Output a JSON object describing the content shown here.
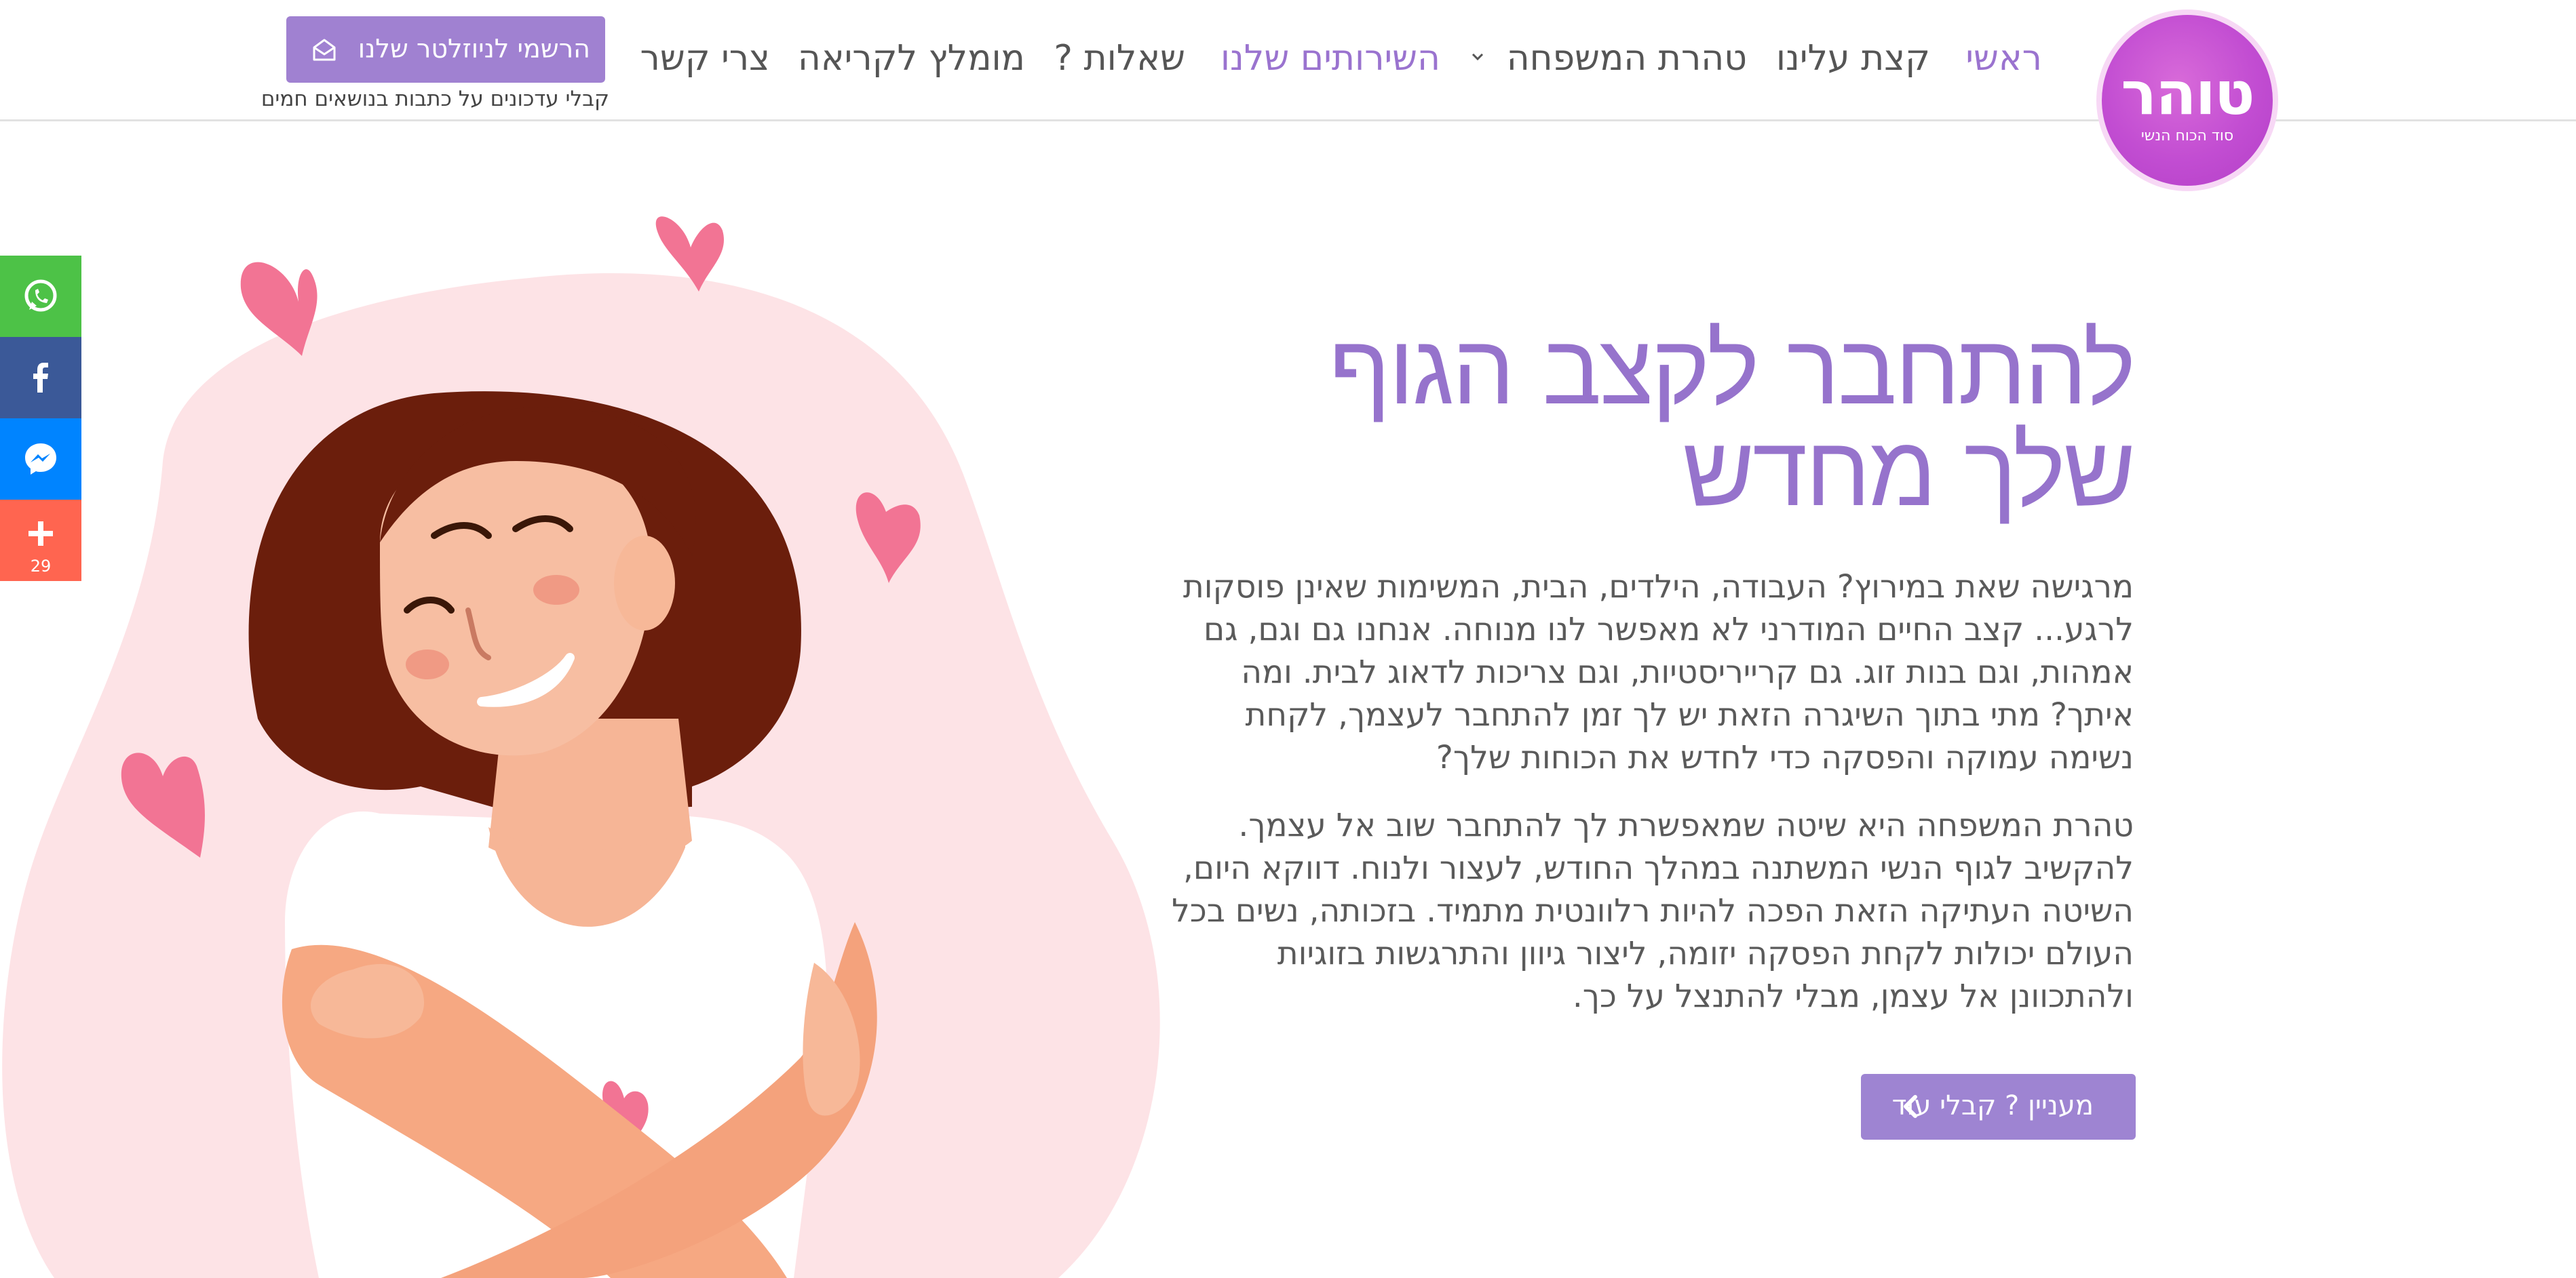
{
  "header": {
    "logo_text": "טוהר",
    "logo_subtitle": "סוד הכוח הנשי",
    "nav": [
      {
        "label": "ראשי",
        "active": true
      },
      {
        "label": "קצת עלינו",
        "active": false
      },
      {
        "label": "טהרת המשפחה",
        "active": false
      },
      {
        "label": "השירותים שלנו",
        "active": true
      },
      {
        "label": "שאלות ?",
        "active": false
      },
      {
        "label": "מומלץ לקריאה",
        "active": false
      },
      {
        "label": "צרי קשר",
        "active": false
      }
    ],
    "newsletter_button": "הרשמי לניוזלטר שלנו",
    "newsletter_subtext": "קבלי עדכונים על כתבות בנושאים חמים"
  },
  "share_bar": {
    "items": [
      {
        "icon": "whatsapp-icon",
        "color": "#4dc247"
      },
      {
        "icon": "facebook-icon",
        "color": "#3b5998"
      },
      {
        "icon": "messenger-icon",
        "color": "#0084ff"
      },
      {
        "icon": "plus-icon",
        "color": "#ff6550",
        "count": "29"
      }
    ]
  },
  "hero": {
    "title": "להתחבר לקצב הגוף שלך מחדש",
    "paragraph1": "מרגישה שאת במירוץ? העבודה, הילדים, הבית, המשימות שאינן פוסקות לרגע... קצב החיים המודרני לא מאפשר לנו מנוחה. אנחנו גם וגם, גם אמהות, וגם בנות זוג. גם קרייריסטיות, וגם צריכות לדאוג לבית. ומה איתך? מתי בתוך השיגרה הזאת יש לך זמן להתחבר לעצמך, לקחת נשימה עמוקה והפסקה כדי לחדש את הכוחות שלך?",
    "paragraph2": "טהרת המשפחה היא שיטה שמאפשרת לך להתחבר שוב אל עצמך. להקשיב לגוף הנשי המשתנה במהלך החודש, לעצור ולנוח. דווקא היום, השיטה העתיקה הזאת הפכה להיות רלוונטית מתמיד. בזכותה, נשים בכל העולם יכולות לקחת הפסקה יזומה, ליצור גיוון והתרגשות בזוגיות ולהתכוונן אל עצמן, מבלי להתנצל על כך.",
    "cta": "מעניין ? קבלי עוד"
  },
  "colors": {
    "accent": "#9673cc",
    "button": "#a081d1",
    "logo": "#c24dd2"
  }
}
